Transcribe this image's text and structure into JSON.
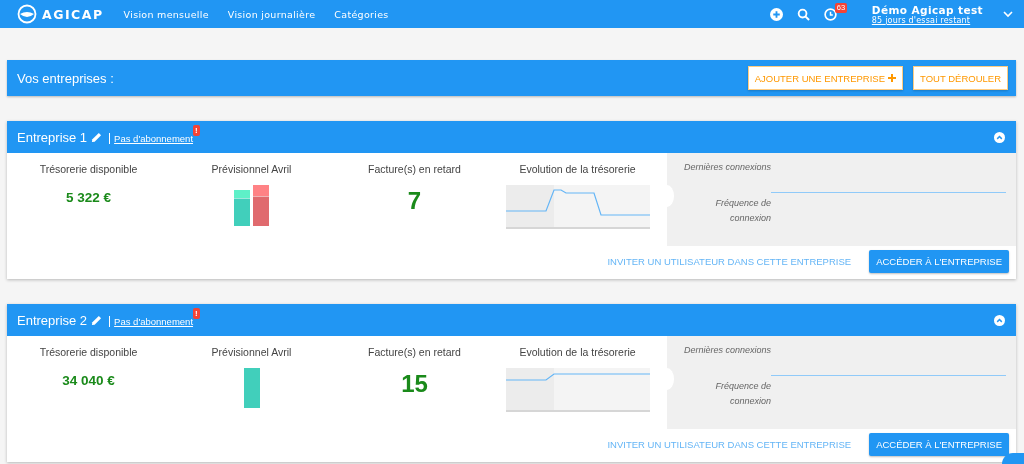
{
  "topbar": {
    "logo": "AGICAP",
    "nav": [
      {
        "label": "Vision mensuelle"
      },
      {
        "label": "Vision journalière"
      },
      {
        "label": "Catégories"
      }
    ],
    "notifications": "63",
    "user": {
      "name": "Démo Agicap test",
      "trial": "85 jours d'essai restant"
    }
  },
  "header": {
    "title": "Vos entreprises :",
    "buttons": [
      {
        "label": "AJOUTER UNE ENTREPRISE",
        "kind": "add"
      },
      {
        "label": "TOUT DÉROULER",
        "kind": "plain"
      }
    ]
  },
  "companies": [
    {
      "name": "Entreprise 1",
      "subscription": "Pas d'abonnement",
      "alert": "!",
      "expanded": true,
      "treasury_label": "Trésorerie disponible",
      "treasury": "5 322 €",
      "forecast_label": "Prévisionnel Avril",
      "forecast_chart": {
        "kind": "two_bars"
      },
      "late_label": "Facture(s) en retard",
      "late": "7",
      "evolution_label": "Evolution de la trésorerie",
      "evolution_chart": {
        "kind": "bump_down"
      },
      "last_login_label": "Dernières connexions",
      "frequency_label": "Fréquence de connexion",
      "invite": "INVITER UN UTILISATEUR DANS CETTE ENTREPRISE",
      "open": "ACCÉDER À L'ENTREPRISE"
    },
    {
      "name": "Entreprise 2",
      "subscription": "Pas d'abonnement",
      "alert": "!",
      "expanded": true,
      "treasury_label": "Trésorerie disponible",
      "treasury": "34 040 €",
      "forecast_label": "Prévisionnel Avril",
      "forecast_chart": {
        "kind": "one_bar"
      },
      "late_label": "Facture(s) en retard",
      "late": "15",
      "evolution_label": "Evolution de la trésorerie",
      "evolution_chart": {
        "kind": "step_up"
      },
      "last_login_label": "Dernières connexions",
      "frequency_label": "Fréquence de connexion",
      "invite": "INVITER UN UTILISATEUR DANS CETTE ENTREPRISE",
      "open": "ACCÉDER À L'ENTREPRISE"
    }
  ]
}
